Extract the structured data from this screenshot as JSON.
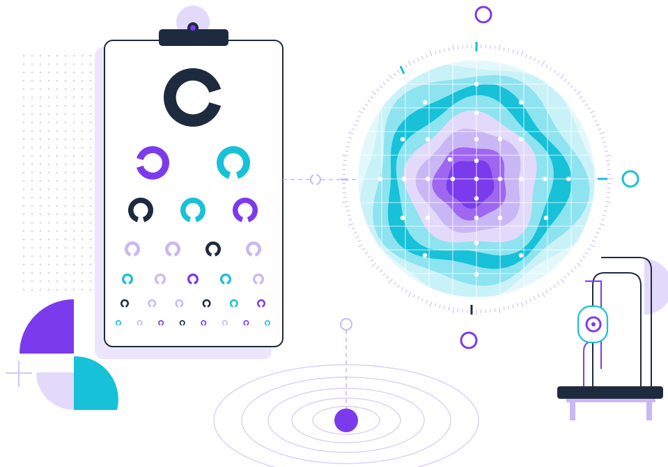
{
  "colors": {
    "navy": "#1e2a3e",
    "purple": "#7c3aed",
    "purple_mid": "#9f67f0",
    "lavender": "#c9b7f5",
    "lavender_light": "#e3dafb",
    "cyan": "#17c1d8",
    "cyan_light": "#8ee3f0",
    "cyan_pale": "#c9f2f8",
    "line": "#c7b9f3"
  },
  "illustration": {
    "eye_chart": {
      "optotype": "landolt-c-ring",
      "rows": [
        [
          {
            "color": "navy",
            "gap": "right"
          }
        ],
        [
          {
            "color": "purple",
            "gap": "left"
          },
          {
            "color": "cyan",
            "gap": "down"
          }
        ],
        [
          {
            "color": "navy",
            "gap": "down"
          },
          {
            "color": "cyan",
            "gap": "down"
          },
          {
            "color": "purple",
            "gap": "down"
          }
        ],
        [
          {
            "color": "lavender",
            "gap": "down"
          },
          {
            "color": "lavender",
            "gap": "down"
          },
          {
            "color": "navy",
            "gap": "down"
          },
          {
            "color": "lavender",
            "gap": "down"
          }
        ],
        [
          {
            "color": "cyan",
            "gap": "down"
          },
          {
            "color": "lavender",
            "gap": "down"
          },
          {
            "color": "purple",
            "gap": "down"
          },
          {
            "color": "cyan",
            "gap": "down"
          },
          {
            "color": "lavender",
            "gap": "down"
          }
        ],
        [
          {
            "color": "navy",
            "gap": "down"
          },
          {
            "color": "lavender",
            "gap": "down"
          },
          {
            "color": "lavender",
            "gap": "down"
          },
          {
            "color": "navy",
            "gap": "down"
          },
          {
            "color": "cyan",
            "gap": "down"
          },
          {
            "color": "purple",
            "gap": "down"
          }
        ],
        [
          {
            "color": "cyan",
            "gap": "down"
          },
          {
            "color": "lavender",
            "gap": "down"
          },
          {
            "color": "purple",
            "gap": "down"
          },
          {
            "color": "navy",
            "gap": "down"
          },
          {
            "color": "purple",
            "gap": "down"
          },
          {
            "color": "lavender",
            "gap": "down"
          },
          {
            "color": "purple",
            "gap": "down"
          },
          {
            "color": "cyan",
            "gap": "down"
          }
        ]
      ]
    },
    "visual_field_map": {
      "contour_layers": [
        "cyan_pale",
        "cyan_light",
        "cyan",
        "cyan_light",
        "lavender_light",
        "lavender",
        "purple_mid",
        "purple"
      ]
    },
    "ophthalmoscope": {
      "icon": "ophthalmoscope-icon"
    },
    "target": {
      "icon": "target-icon"
    },
    "decoration": {
      "icons": [
        "dot-grid-icon",
        "quarter-circles-icon",
        "crosshair-icon"
      ]
    }
  }
}
